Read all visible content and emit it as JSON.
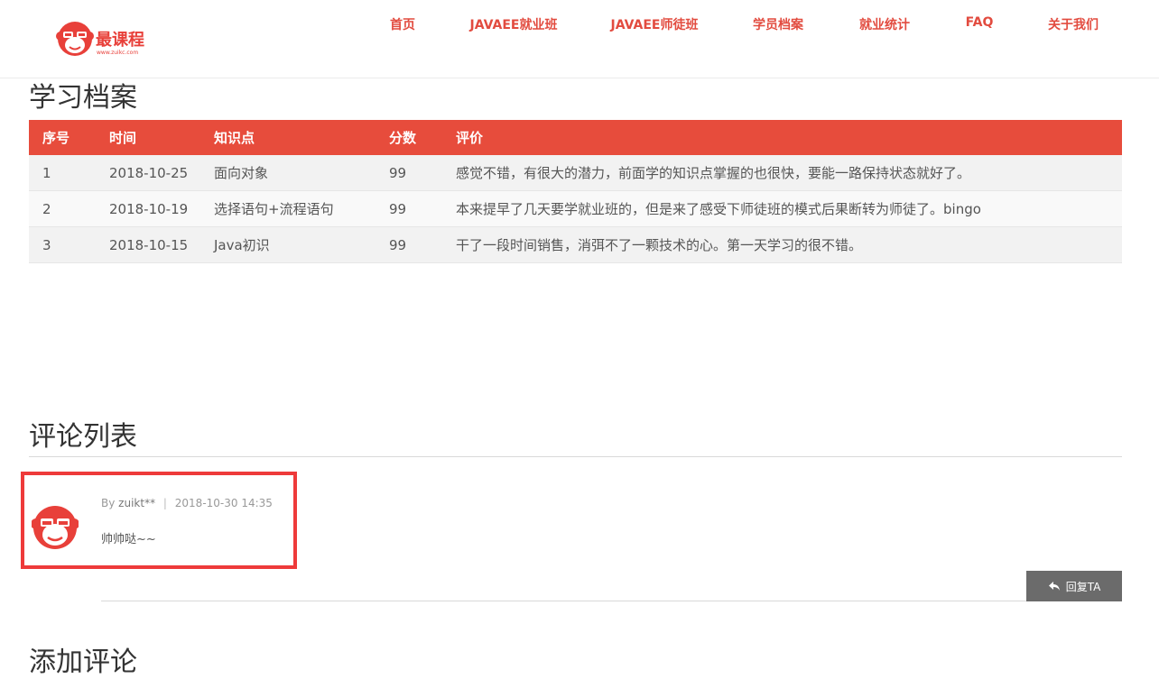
{
  "brand": {
    "name": "最课程",
    "url": "www.zuikc.com"
  },
  "nav": {
    "items": [
      {
        "label": "首页"
      },
      {
        "label": "JAVAEE就业班"
      },
      {
        "label": "JAVAEE师徒班"
      },
      {
        "label": "学员档案"
      },
      {
        "label": "就业统计"
      },
      {
        "label": "FAQ"
      },
      {
        "label": "关于我们"
      }
    ]
  },
  "records": {
    "title": "学习档案",
    "columns": [
      "序号",
      "时间",
      "知识点",
      "分数",
      "评价"
    ],
    "rows": [
      [
        "1",
        "2018-10-25",
        "面向对象",
        "99",
        "感觉不错，有很大的潜力，前面学的知识点掌握的也很快，要能一路保持状态就好了。"
      ],
      [
        "2",
        "2018-10-19",
        "选择语句+流程语句",
        "99",
        "本来提早了几天要学就业班的，但是来了感受下师徒班的模式后果断转为师徒了。bingo"
      ],
      [
        "3",
        "2018-10-15",
        "Java初识",
        "99",
        "干了一段时间销售，消弭不了一颗技术的心。第一天学习的很不错。"
      ]
    ]
  },
  "comments": {
    "title": "评论列表",
    "items": [
      {
        "by": "By",
        "author": "zuikt**",
        "separator": "|",
        "time": "2018-10-30 14:35",
        "text": "帅帅哒~~"
      }
    ],
    "reply_label": "回复TA"
  },
  "add_comment": {
    "title": "添加评论"
  },
  "colors": {
    "accent": "#e74c3c",
    "nav_text": "#e24b3f",
    "highlight_border": "#ee3a3a",
    "reply_button": "#6b6b6b"
  }
}
